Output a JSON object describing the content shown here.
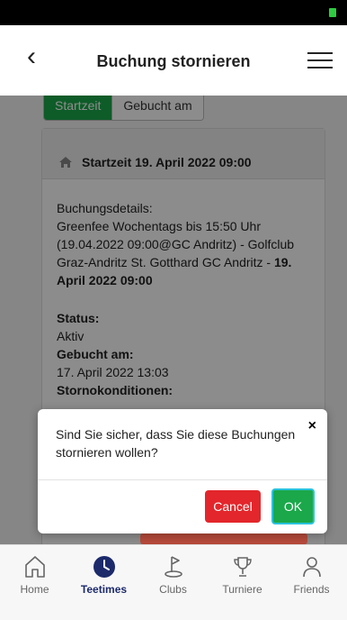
{
  "header": {
    "title": "Buchung stornieren"
  },
  "segments": {
    "active": "Startzeit",
    "inactive": "Gebucht am"
  },
  "card": {
    "head": "Startzeit 19. April 2022 09:00",
    "details_label": "Buchungsdetails:",
    "details_text": "Greenfee Wochentags bis 15:50 Uhr (19.04.2022 09:00@GC Andritz) - Golfclub Graz-Andritz St. Gotthard GC Andritz - ",
    "details_bold": "19. April 2022 09:00",
    "status_label": "Status:",
    "status_value": "Aktiv",
    "booked_label": "Gebucht am:",
    "booked_value": "17. April 2022 13:03",
    "cancel_cond_label": "Stornokonditionen:"
  },
  "dialog": {
    "message": "Sind Sie sicher, dass Sie diese Buchungen stornieren wollen?",
    "close": "×",
    "cancel_label": "Cancel",
    "ok_label": "OK"
  },
  "tabs": [
    {
      "label": "Home",
      "icon": "home-icon",
      "active": false
    },
    {
      "label": "Teetimes",
      "icon": "clock-icon",
      "active": true
    },
    {
      "label": "Clubs",
      "icon": "golf-flag-icon",
      "active": false
    },
    {
      "label": "Turniere",
      "icon": "trophy-icon",
      "active": false
    },
    {
      "label": "Friends",
      "icon": "person-icon",
      "active": false
    }
  ],
  "colors": {
    "accent_green": "#1aa84a",
    "danger_red": "#e3262b",
    "tab_active": "#1c2a6b"
  }
}
